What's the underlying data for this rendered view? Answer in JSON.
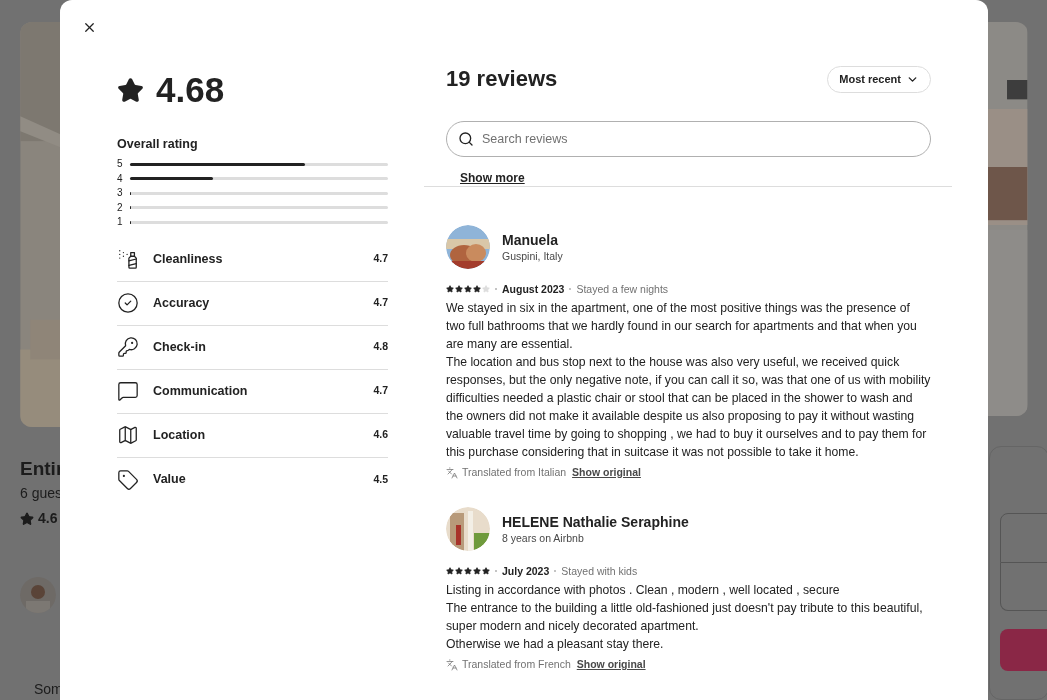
{
  "background": {
    "title": "Entir",
    "subtitle": "6 gues",
    "rating": "4.6",
    "footer": "Som"
  },
  "summary": {
    "rating": "4.68",
    "overall_label": "Overall rating",
    "bars": [
      {
        "label": "5",
        "level": 0.68
      },
      {
        "label": "4",
        "level": 0.32
      },
      {
        "label": "3",
        "level": 0
      },
      {
        "label": "2",
        "level": 0
      },
      {
        "label": "1",
        "level": 0
      }
    ],
    "categories": [
      {
        "kind": "cleanliness",
        "label": "Cleanliness",
        "value": "4.7"
      },
      {
        "kind": "accuracy",
        "label": "Accuracy",
        "value": "4.7"
      },
      {
        "kind": "checkin",
        "label": "Check-in",
        "value": "4.8"
      },
      {
        "kind": "communication",
        "label": "Communication",
        "value": "4.7"
      },
      {
        "kind": "location",
        "label": "Location",
        "value": "4.6"
      },
      {
        "kind": "value",
        "label": "Value",
        "value": "4.5"
      }
    ]
  },
  "reviews_header": {
    "title": "19 reviews",
    "sort": "Most recent",
    "search": {
      "placeholder": "Search reviews"
    }
  },
  "previous_link": "Show more",
  "reviews": [
    {
      "name": "Manuela",
      "meta": "Guspini, Italy",
      "stars": 4,
      "date": "August 2023",
      "stay": "Stayed a few nights",
      "paragraphs": [
        "We stayed in six in the apartment, one of the most positive things was the presence of two full bathrooms that we hardly found in our search for apartments and that when you are many are essential.",
        "The location and bus stop next to the house was also very useful, we received quick responses, but the only negative note, if you can call it so, was that one of us with mobility difficulties needed a plastic chair or stool that can be placed in the shower to wash and the owners did not make it available despite us also proposing to pay it without wasting valuable travel time by going to shopping , we had to buy it ourselves and to pay them for this purchase considering that in suitcase it was not possible to take it home."
      ],
      "translated": "Translated from Italian",
      "link": "Show original"
    },
    {
      "name": "HELENE Nathalie Seraphine",
      "meta": "8 years on Airbnb",
      "stars": 5,
      "date": "July 2023",
      "stay": "Stayed with kids",
      "paragraphs": [
        "Listing in accordance with photos . Clean , modern , well located , secure",
        "The entrance to the building a little old-fashioned just doesn't pay tribute to this beautiful, super modern and nicely decorated apartment.",
        "Otherwise we had a pleasant stay there."
      ],
      "translated": "Translated from French",
      "link": "Show original"
    }
  ]
}
